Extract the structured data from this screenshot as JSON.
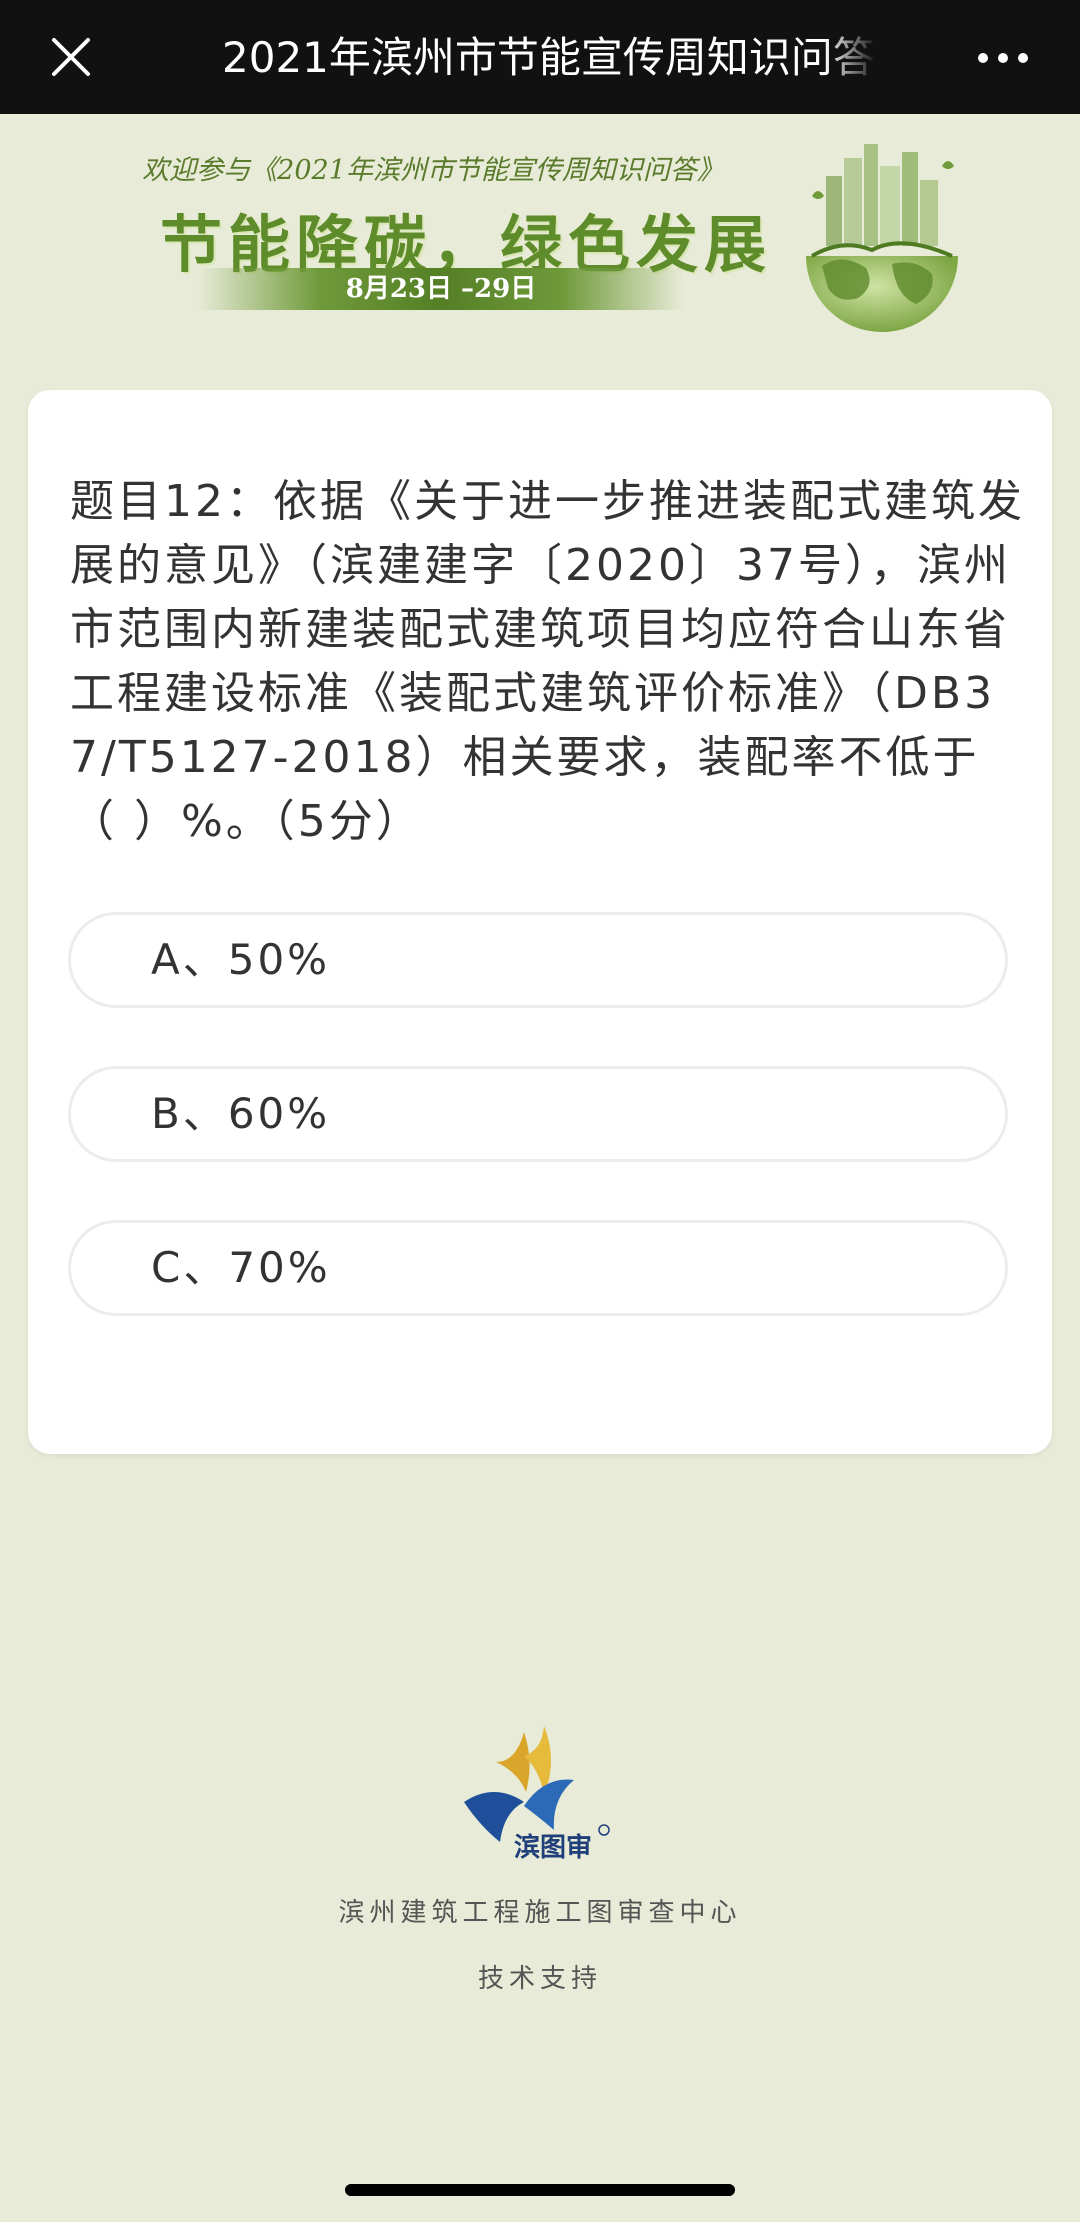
{
  "topbar": {
    "title": "2021年滨州市节能宣传周知识问答",
    "close_icon": "close-icon",
    "more_icon": "more-dots-icon"
  },
  "banner": {
    "welcome": "欢迎参与《2021年滨州市节能宣传周知识问答》",
    "slogan": "节能降碳，绿色发展",
    "dates": "8月23日 –29日",
    "illustration": "green-earth-city-icon"
  },
  "question": {
    "text": "题目12：依据《关于进一步推进装配式建筑发展的意见》（滨建建字〔2020〕37号），滨州市范围内新建装配式建筑项目均应符合山东省工程建设标准《装配式建筑评价标准》（DB37/T5127-2018）相关要求，装配率不低于（  ）%。（5分）",
    "options": [
      {
        "label": "A、50%"
      },
      {
        "label": "B、60%"
      },
      {
        "label": "C、70%"
      }
    ]
  },
  "footer": {
    "logo_text": "滨图审",
    "organization": "滨州建筑工程施工图审查中心",
    "support": "技术支持"
  },
  "colors": {
    "background": "#e8ebd7",
    "topbar": "#111111",
    "accent_green": "#5f8c2a",
    "card": "#ffffff"
  }
}
